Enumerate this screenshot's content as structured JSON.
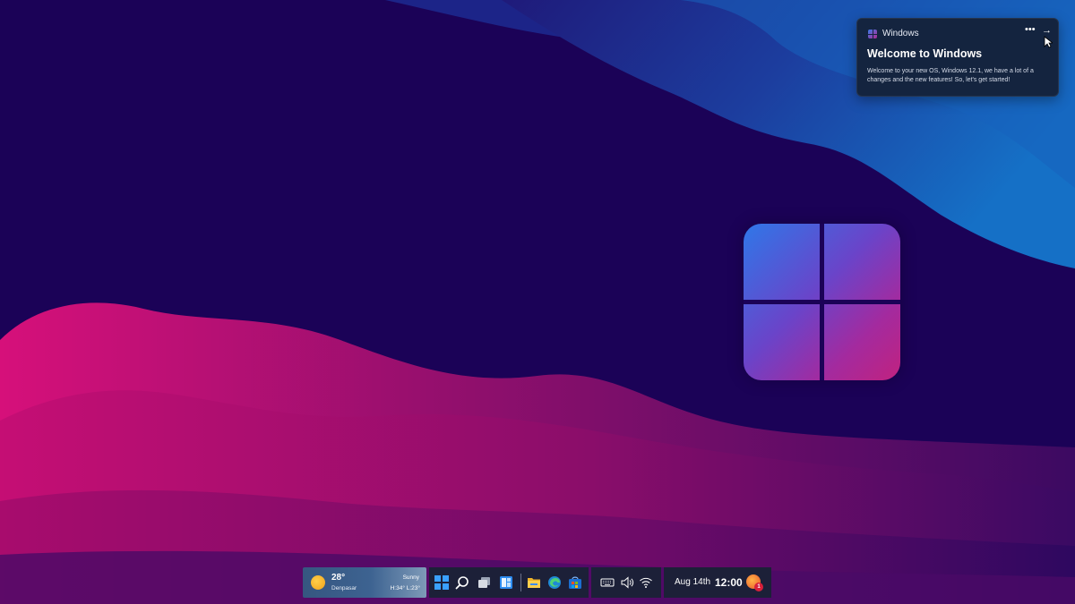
{
  "notification": {
    "app_name": "Windows",
    "more_icon": "more-dots-icon",
    "arrow_icon": "arrow-right-icon",
    "title": "Welcome to Windows",
    "body": "Welcome to your new OS, Windows 12.1, we have a lot of a changes and the new features! So, let's get started!"
  },
  "weather": {
    "icon": "sun-icon",
    "temp": "28°",
    "city": "Denpasar",
    "condition": "Sunny",
    "hilo": "H:34° L:23°"
  },
  "taskbar": {
    "apps": [
      "start-icon",
      "search-icon",
      "task-view-icon",
      "widgets-icon",
      "file-explorer-icon",
      "edge-icon",
      "store-icon"
    ],
    "tray": [
      "keyboard-icon",
      "volume-icon",
      "wifi-icon"
    ]
  },
  "clock": {
    "date": "Aug 14th",
    "time": "12:00",
    "notification_count": "1"
  },
  "colors": {
    "background": "#1b0257",
    "accent_blue": "#2f77e8",
    "accent_pink": "#c1227f",
    "taskbar": "#1c2038"
  }
}
